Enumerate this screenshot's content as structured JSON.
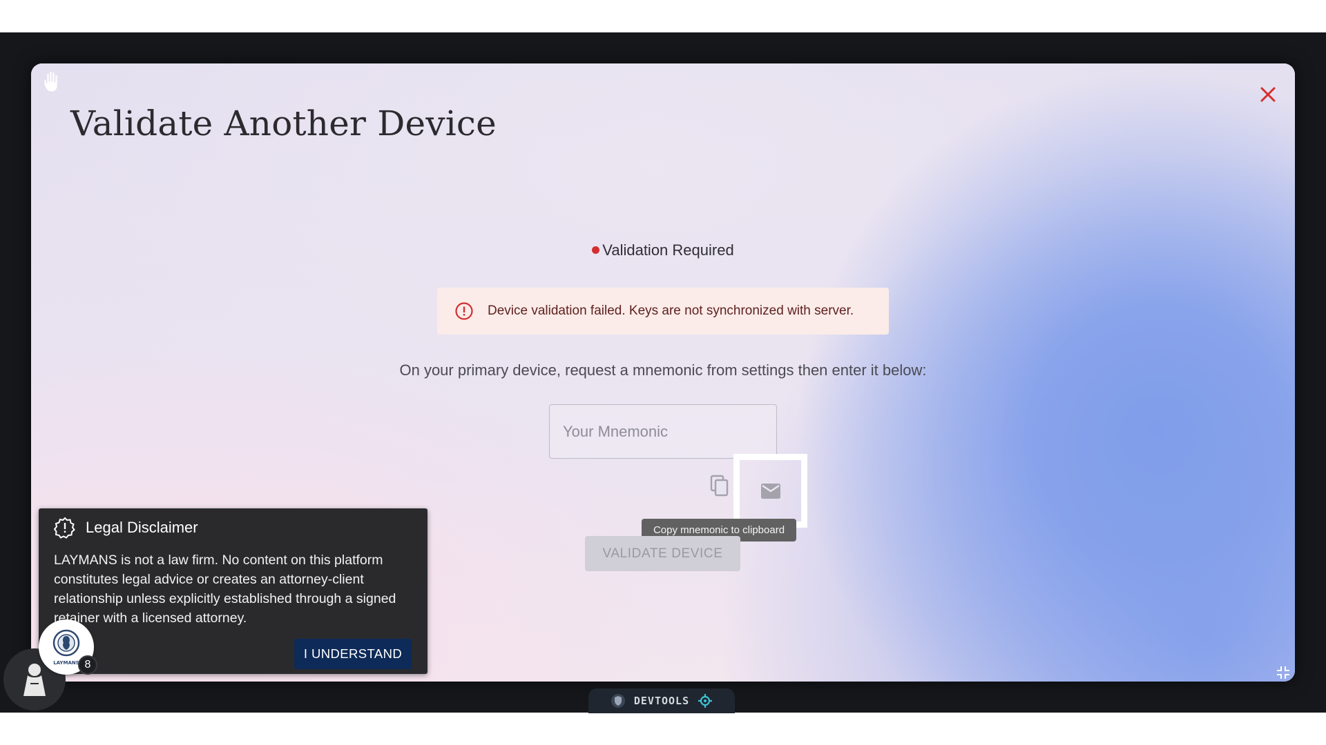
{
  "modal": {
    "title": "Validate Another Device",
    "status_label": "Validation Required",
    "alert_message": "Device validation failed. Keys are not synchronized with server.",
    "instruction": "On your primary device, request a mnemonic from settings then enter it below:",
    "mnemonic_placeholder": "Your Mnemonic",
    "tooltip": "Copy mnemonic to clipboard",
    "validate_label": "VALIDATE DEVICE"
  },
  "disclaimer": {
    "title": "Legal Disclaimer",
    "body": "LAYMANS is not a law firm. No content on this platform constitutes legal advice or creates an attorney-client relationship unless explicitly established through a signed retainer with a licensed attorney.",
    "button_label": "I UNDERSTAND"
  },
  "avatar": {
    "logo_text": "LAYMANS",
    "badge_count": "8"
  },
  "devtools": {
    "label": "DEVTOOLS"
  },
  "colors": {
    "error_red": "#d32f2f",
    "alert_bg": "#fbece9",
    "button_navy": "#0d2a58",
    "accent_teal": "#3fc3d6"
  }
}
